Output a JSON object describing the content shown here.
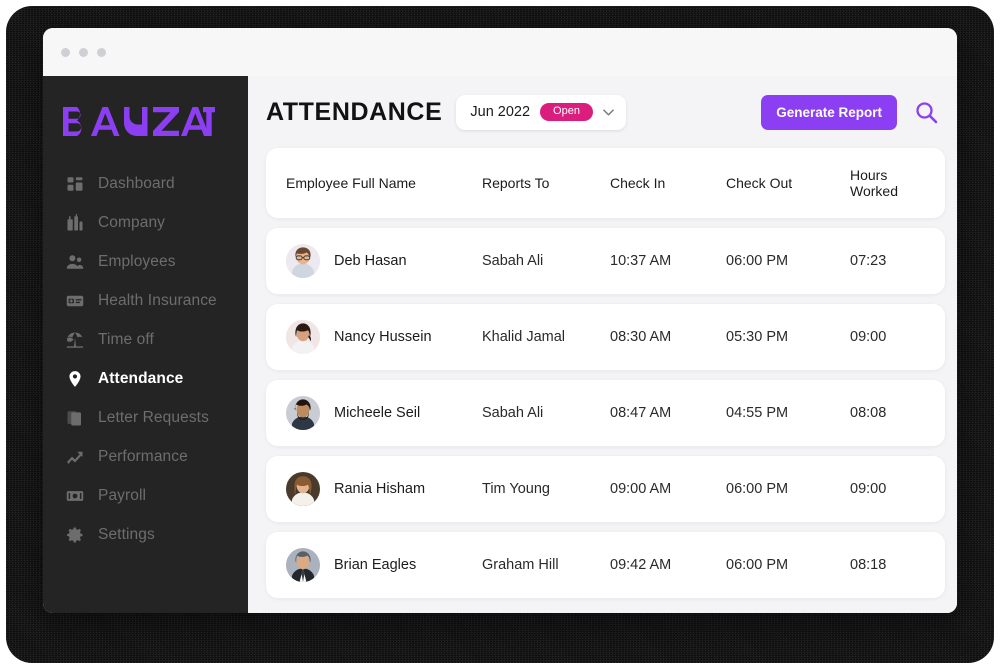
{
  "window": {
    "traffic_dots": 3
  },
  "sidebar": {
    "logo_text": "BAYZAT",
    "logo_color": "#8C3FF2",
    "background": "#242424",
    "items": [
      {
        "label": "Dashboard",
        "icon": "dashboard-icon",
        "active": false
      },
      {
        "label": "Company",
        "icon": "company-icon",
        "active": false
      },
      {
        "label": "Employees",
        "icon": "employees-icon",
        "active": false
      },
      {
        "label": "Health Insurance",
        "icon": "health-insurance-icon",
        "active": false
      },
      {
        "label": "Time off",
        "icon": "time-off-icon",
        "active": false
      },
      {
        "label": "Attendance",
        "icon": "location-pin-icon",
        "active": true
      },
      {
        "label": "Letter Requests",
        "icon": "document-icon",
        "active": false
      },
      {
        "label": "Performance",
        "icon": "trending-up-icon",
        "active": false
      },
      {
        "label": "Payroll",
        "icon": "money-icon",
        "active": false
      },
      {
        "label": "Settings",
        "icon": "gear-icon",
        "active": false
      }
    ]
  },
  "header": {
    "title": "ATTENDANCE",
    "month_selector": {
      "value": "Jun 2022",
      "badge": "Open",
      "badge_color": "#DB1E7E",
      "chevron": "chevron-down-icon"
    },
    "generate_report_label": "Generate Report",
    "generate_report_color": "#8C3FF2",
    "search_icon": "search-icon"
  },
  "table": {
    "columns": [
      "Employee Full Name",
      "Reports To",
      "Check In",
      "Check Out",
      "Hours Worked"
    ],
    "rows": [
      {
        "name": "Deb Hasan",
        "reports_to": "Sabah Ali",
        "check_in": "10:37 AM",
        "check_out": "06:00 PM",
        "hours": "07:23",
        "avatar": "avatar-male-glasses"
      },
      {
        "name": "Nancy Hussein",
        "reports_to": "Khalid Jamal",
        "check_in": "08:30 AM",
        "check_out": "05:30 PM",
        "hours": "09:00",
        "avatar": "avatar-female-dark-hair"
      },
      {
        "name": "Micheele Seil",
        "reports_to": "Sabah Ali",
        "check_in": "08:47 AM",
        "check_out": "04:55 PM",
        "hours": "08:08",
        "avatar": "avatar-male-beard"
      },
      {
        "name": "Rania Hisham",
        "reports_to": "Tim Young",
        "check_in": "09:00 AM",
        "check_out": "06:00 PM",
        "hours": "09:00",
        "avatar": "avatar-female-long-hair"
      },
      {
        "name": "Brian Eagles",
        "reports_to": "Graham Hill",
        "check_in": "09:42 AM",
        "check_out": "06:00 PM",
        "hours": "08:18",
        "avatar": "avatar-male-suit"
      }
    ]
  }
}
